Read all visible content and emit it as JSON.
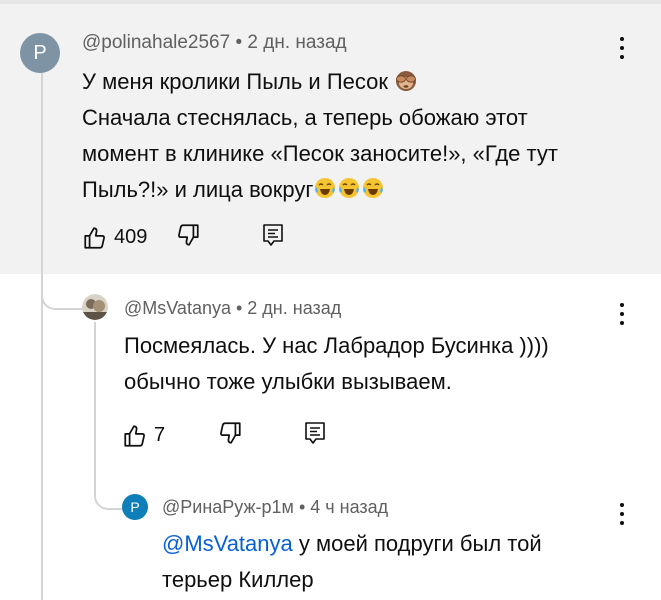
{
  "comment": {
    "avatar_letter": "P",
    "avatar_color": "#7e93a3",
    "author": "@polinahale2567",
    "time": "2 дн. назад",
    "lines": [
      "У меня кролики Пыль и Песок",
      "Сначала стеснялась, а теперь обожаю этот",
      "момент в клинике «Песок заносите!», «Где тут",
      "Пыль?!» и лица вокруг"
    ],
    "emoji": [
      "see-no-evil-monkey-emoji",
      "tears-of-joy-emoji"
    ],
    "like_count": "409"
  },
  "reply1": {
    "author": "@MsVatanya",
    "time": "2 дн. назад",
    "lines": [
      "Посмеялась. У нас Лабрадор Бусинка ))))",
      "обычно тоже улыбки вызываем."
    ],
    "like_count": "7"
  },
  "reply2": {
    "avatar_letter": "P",
    "avatar_color": "#0e7fb8",
    "author": "@РинаРуж-р1м",
    "time": "4 ч назад",
    "mention": "@MsVatanya",
    "line1_rest": " у моей подруги был той",
    "line2": "терьер Киллер"
  },
  "separator": " • ",
  "colors": {
    "background": "#ffffff",
    "highlight": "#f2f2f2",
    "meta_text": "#606060",
    "mention": "#065fd4",
    "thread_line": "#d4d4d4"
  }
}
